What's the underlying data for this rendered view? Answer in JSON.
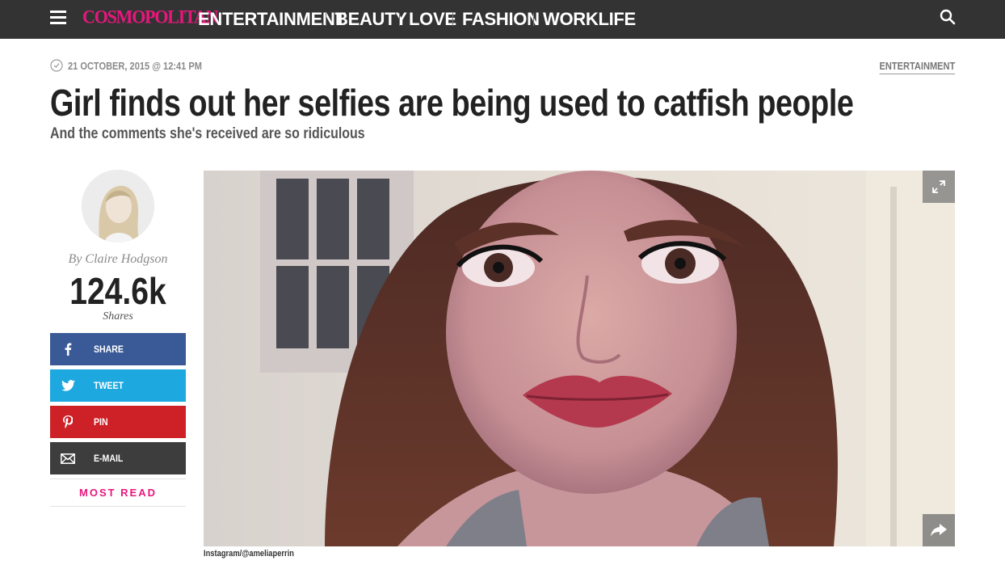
{
  "nav": {
    "logo": "COSMOPOLITAN",
    "links": [
      "ENTERTAINMENT",
      "BEAUTY",
      "LOVE",
      "FASHION",
      "WORKLIFE"
    ],
    "menu_icon": "hamburger-icon",
    "search_icon": "search-icon",
    "background": "#333333",
    "logo_color": "#e8177d"
  },
  "article": {
    "date": "21 OCTOBER, 2015 @ 12:41 PM",
    "category": "ENTERTAINMENT",
    "headline": "Girl finds out her selfies are being used to catfish people",
    "subhead": "And the comments she's received are so ridiculous",
    "image_caption": "Instagram/@ameliaperrin"
  },
  "author": {
    "byline": "By Claire Hodgson"
  },
  "shares": {
    "count": "124.6k",
    "label": "Shares",
    "buttons": [
      {
        "label": "SHARE",
        "icon": "facebook-icon",
        "color": "#3a5a97"
      },
      {
        "label": "TWEET",
        "icon": "twitter-icon",
        "color": "#1da8e0"
      },
      {
        "label": "PIN",
        "icon": "pinterest-icon",
        "color": "#cd2127"
      },
      {
        "label": "E-MAIL",
        "icon": "email-icon",
        "color": "#3d3d3d"
      }
    ]
  },
  "most_read": "MOST READ"
}
